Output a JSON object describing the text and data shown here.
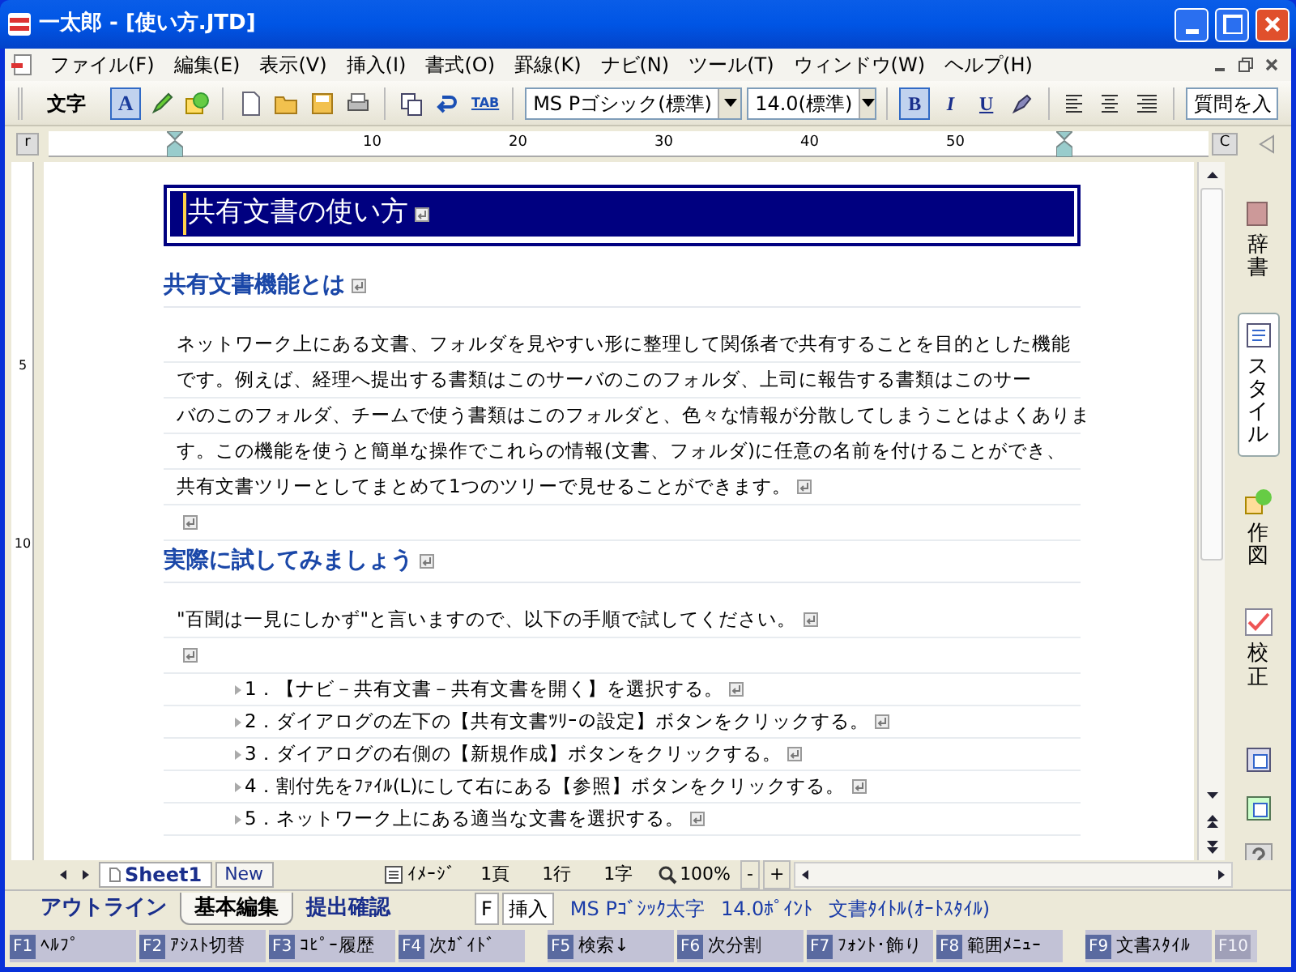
{
  "window": {
    "title": "一太郎 - [使い方.JTD]"
  },
  "menu": [
    {
      "label": "ファイル(F)"
    },
    {
      "label": "編集(E)"
    },
    {
      "label": "表示(V)"
    },
    {
      "label": "挿入(I)"
    },
    {
      "label": "書式(O)"
    },
    {
      "label": "罫線(K)"
    },
    {
      "label": "ナビ(N)"
    },
    {
      "label": "ツール(T)"
    },
    {
      "label": "ウィンドウ(W)"
    },
    {
      "label": "ヘルプ(H)"
    }
  ],
  "toolbar": {
    "label": "文字",
    "mode_buttons": [
      {
        "kind": "letter",
        "label": "A",
        "selected": true
      },
      {
        "kind": "pen",
        "selected": false
      },
      {
        "kind": "shape",
        "selected": false
      }
    ],
    "tab_button": "TAB",
    "font": "MS Pゴシック(標準)",
    "size": "14.0(標準)",
    "style_buttons": [
      {
        "label": "B",
        "selected": true
      },
      {
        "label": "I",
        "selected": false
      },
      {
        "label": "U",
        "selected": false
      }
    ],
    "question_field": "質問を入"
  },
  "ruler": {
    "corner_left": "r",
    "corner_right": "C",
    "numbers": [
      "10",
      "20",
      "30",
      "40",
      "50"
    ]
  },
  "vertical_ruler": [
    "5",
    "10"
  ],
  "document": [
    {
      "kind": "title",
      "text": "共有文書の使い方"
    },
    {
      "kind": "heading",
      "text": "共有文書機能とは"
    },
    {
      "kind": "paragraph",
      "lines": [
        "ネットワーク上にある文書、フォルダを見やすい形に整理して関係者で共有することを目的とした機能",
        "です。例えば、経理へ提出する書類はこのサーバのこのフォルダ、上司に報告する書類はこのサー",
        "バのこのフォルダ、チームで使う書類はこのフォルダと、色々な情報が分散してしまうことはよくありま",
        "す。この機能を使うと簡単な操作でこれらの情報(文書、フォルダ)に任意の名前を付けることができ、",
        "共有文書ツリーとしてまとめて1つのツリーで見せることができます。"
      ]
    },
    {
      "kind": "empty"
    },
    {
      "kind": "heading",
      "text": "実際に試してみましょう"
    },
    {
      "kind": "paragraph",
      "lines": [
        "\"百聞は一見にしかず\"と言いますので、以下の手順で試してください。"
      ]
    },
    {
      "kind": "empty"
    },
    {
      "kind": "list_item",
      "text": "1．【ナビ－共有文書－共有文書を開く】を選択する。"
    },
    {
      "kind": "list_item",
      "text": "2．ダイアログの左下の【共有文書ﾂﾘｰの設定】ボタンをクリックする。"
    },
    {
      "kind": "list_item",
      "text": "3．ダイアログの右側の【新規作成】ボタンをクリックする。"
    },
    {
      "kind": "list_item",
      "text": "4．割付先をﾌｧｲﾙ(L)にして右にある【参照】ボタンをクリックする。"
    },
    {
      "kind": "list_item",
      "text": "5．ネットワーク上にある適当な文書を選択する。"
    }
  ],
  "sidebar": [
    {
      "label": "辞書",
      "selected": false
    },
    {
      "label": "スタイル",
      "selected": true
    },
    {
      "label": "作図",
      "selected": false
    },
    {
      "label": "校正",
      "selected": false
    }
  ],
  "sheet_bar": {
    "tabs": [
      {
        "label": "Sheet1",
        "selected": true
      },
      {
        "label": "New",
        "selected": false
      }
    ],
    "view": "ｲﾒｰｼﾞ",
    "page": "1頁",
    "line": "1行",
    "char": "1字",
    "zoom": "100%",
    "zoom_out": "-",
    "zoom_in": "+"
  },
  "mode_tabs": [
    {
      "label": "アウトライン",
      "selected": false
    },
    {
      "label": "基本編集",
      "selected": true
    },
    {
      "label": "提出確認",
      "selected": false
    }
  ],
  "status": {
    "f_label": "F",
    "insert": "挿入",
    "font": "MS Pｺﾞｼｯｸ太字",
    "size": "14.0ﾎﾟｲﾝﾄ",
    "style": "文書ﾀｲﾄﾙ(ｵｰﾄｽﾀｲﾙ)"
  },
  "function_keys": [
    {
      "key": "F1",
      "label": "ﾍﾙﾌﾟ",
      "disabled": false
    },
    {
      "key": "F2",
      "label": "ｱｼｽﾄ切替",
      "disabled": false
    },
    {
      "key": "F3",
      "label": "ｺﾋﾟｰ履歴",
      "disabled": false
    },
    {
      "key": "F4",
      "label": "次ｶﾞｲﾄﾞ",
      "disabled": false
    },
    {
      "key": "F5",
      "label": "検索↓",
      "disabled": false
    },
    {
      "key": "F6",
      "label": "次分割",
      "disabled": false
    },
    {
      "key": "F7",
      "label": "ﾌｫﾝﾄ･飾り",
      "disabled": false
    },
    {
      "key": "F8",
      "label": "範囲ﾒﾆｭｰ",
      "disabled": false
    },
    {
      "key": "F9",
      "label": "文書ｽﾀｲﾙ",
      "disabled": false
    },
    {
      "key": "F10",
      "disabled": true
    }
  ]
}
